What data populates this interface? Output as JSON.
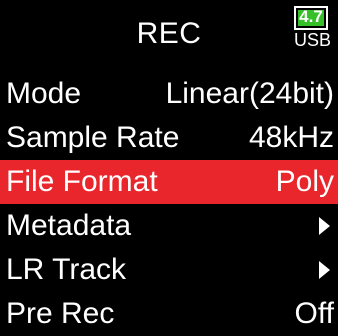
{
  "header": {
    "title": "REC",
    "battery": {
      "level_text": "4.7",
      "source": "USB",
      "fill_fraction": 1.0,
      "fill_color": "#35c02a"
    }
  },
  "colors": {
    "background": "#000000",
    "text": "#ffffff",
    "selected_row": "#e8262c"
  },
  "menu": {
    "items": [
      {
        "label": "Mode",
        "value": "Linear(24bit)",
        "selected": false,
        "submenu": false
      },
      {
        "label": "Sample Rate",
        "value": "48kHz",
        "selected": false,
        "submenu": false
      },
      {
        "label": "File Format",
        "value": "Poly",
        "selected": true,
        "submenu": false
      },
      {
        "label": "Metadata",
        "value": "",
        "selected": false,
        "submenu": true,
        "icon": "right-arrow-icon"
      },
      {
        "label": "LR Track",
        "value": "",
        "selected": false,
        "submenu": true,
        "icon": "right-arrow-icon"
      },
      {
        "label": "Pre Rec",
        "value": "Off",
        "selected": false,
        "submenu": false
      }
    ]
  }
}
